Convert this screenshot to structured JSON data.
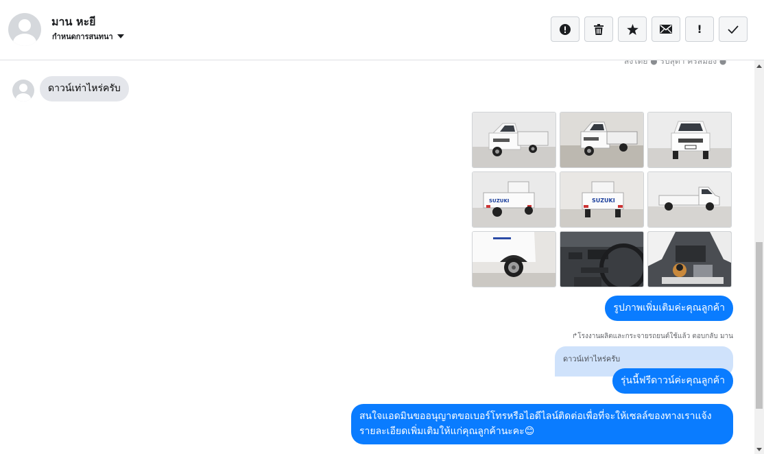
{
  "header": {
    "contact_name": "มาน หะยี",
    "assign_label": "กำหนดการสนทนา",
    "toolbar": {
      "icons": [
        "alert-circle-icon",
        "trash-icon",
        "star-icon",
        "envelope-icon",
        "exclamation-icon",
        "checkmark-icon"
      ],
      "glyphs": [
        "!",
        "🗑",
        "★",
        "✉",
        "!",
        "✓"
      ]
    }
  },
  "conversation": {
    "cut_top_text": "ส่งโดย ● รับสุดา ครสมอง ●",
    "incoming": [
      {
        "text": "ดาวน์เท่าไหร่ครับ"
      }
    ],
    "photos": [
      {
        "name": "truck-front-left"
      },
      {
        "name": "truck-front-left-2"
      },
      {
        "name": "truck-front"
      },
      {
        "name": "truck-rear-left"
      },
      {
        "name": "truck-rear"
      },
      {
        "name": "truck-side"
      },
      {
        "name": "truck-wheel-closeup"
      },
      {
        "name": "truck-dashboard"
      },
      {
        "name": "truck-engine"
      }
    ],
    "outgoing": [
      {
        "text": "รูปภาพเพิ่มเติมค่ะคุณลูกค้า"
      },
      {
        "text": "รุ่นนี้ฟรีดาวน์ค่ะคุณลูกค้า"
      },
      {
        "text": "สนใจแอดมินขออนุญาตขอเบอร์โทรหรือไอดีไลน์ติดต่อเพื่อที่จะให้เซลล์ของทางเราแจ้งรายละเอียดเพิ่มเติมให้แก่คุณลูกค้านะคะ😊"
      }
    ],
    "reply_note": "↱โรงงานผลิตและกระจายรถยนต์ใช้แล้ว ตอบกลับ มาน",
    "quoted_text": "ดาวน์เท่าไหร่ครับ"
  },
  "colors": {
    "outgoing_bubble": "#0a7cff",
    "incoming_bubble": "#e4e6eb",
    "quoted_bubble": "#cfe2fb"
  }
}
